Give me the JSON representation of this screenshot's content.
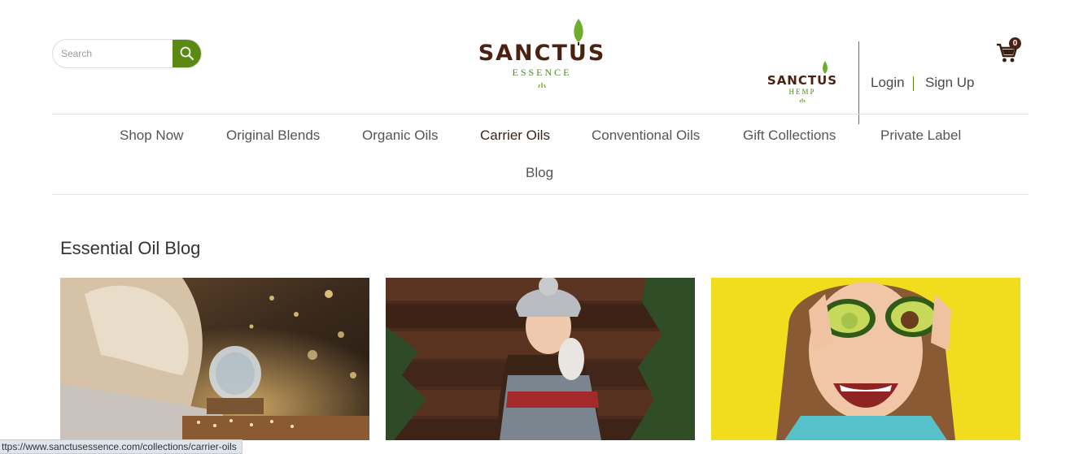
{
  "search": {
    "placeholder": "Search",
    "value": ""
  },
  "logo": {
    "name": "SANCTUS",
    "sub": "ESSENCE"
  },
  "hemp_logo": {
    "name": "SANCTUS",
    "sub": "HEMP"
  },
  "auth": {
    "login": "Login",
    "signup": "Sign Up"
  },
  "cart": {
    "count": "0"
  },
  "nav": [
    {
      "label": "Shop Now"
    },
    {
      "label": "Original Blends"
    },
    {
      "label": "Organic Oils"
    },
    {
      "label": "Carrier Oils"
    },
    {
      "label": "Conventional Oils"
    },
    {
      "label": "Gift Collections"
    },
    {
      "label": "Private Label"
    },
    {
      "label": "Blog"
    }
  ],
  "blog": {
    "title": "Essential Oil Blog",
    "cards": [
      {
        "image": "girl-snow-globe-photo"
      },
      {
        "image": "woman-winter-hat-photo"
      },
      {
        "image": "woman-avocado-eyes-photo"
      }
    ]
  },
  "status_bar": {
    "url": "ttps://www.sanctusessence.com/collections/carrier-oils"
  },
  "colors": {
    "brand_green": "#5a8a12",
    "brand_brown": "#4b2212"
  }
}
